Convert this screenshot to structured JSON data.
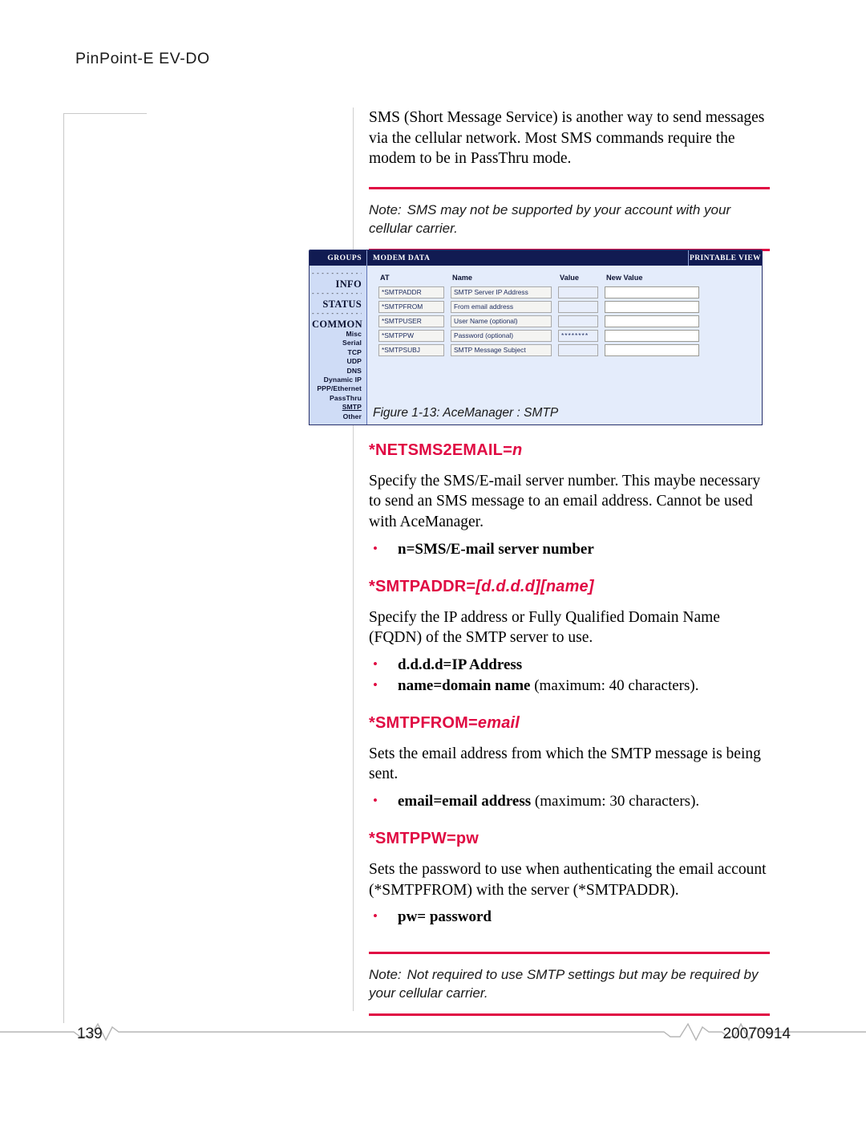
{
  "header": {
    "running_title": "PinPoint-E EV-DO"
  },
  "intro": {
    "paragraph": "SMS (Short Message Service) is another way to send messages via the cellular network. Most SMS commands require the modem to be in PassThru mode."
  },
  "note_top": {
    "label": "Note:",
    "text": "SMS may not be supported by your account with your cellular carrier."
  },
  "figure": {
    "caption": "Figure 1-13: AceManager : SMTP",
    "topbar": {
      "groups": "GROUPS",
      "modem_data": "MODEM DATA",
      "printable_view": "PRINTABLE VIEW"
    },
    "sidebar": {
      "dashes": "- - - - - - - - - - - -",
      "info": "INFO",
      "status": "STATUS",
      "common": "COMMON",
      "items": [
        "Misc",
        "Serial",
        "TCP",
        "UDP",
        "DNS",
        "Dynamic IP",
        "PPP/Ethernet",
        "PassThru",
        "SMTP",
        "Other"
      ],
      "active_item": "SMTP"
    },
    "table": {
      "columns": [
        "AT",
        "Name",
        "Value",
        "New Value"
      ],
      "rows": [
        {
          "at": "*SMTPADDR",
          "name": "SMTP Server IP Address",
          "value": "",
          "new_value": ""
        },
        {
          "at": "*SMTPFROM",
          "name": "From email address",
          "value": "",
          "new_value": ""
        },
        {
          "at": "*SMTPUSER",
          "name": "User Name (optional)",
          "value": "",
          "new_value": ""
        },
        {
          "at": "*SMTPPW",
          "name": "Password (optional)",
          "value": "********",
          "new_value": ""
        },
        {
          "at": "*SMTPSUBJ",
          "name": "SMTP Message Subject",
          "value": "",
          "new_value": ""
        }
      ]
    }
  },
  "sections": [
    {
      "command_prefix": "*NETSMS2EMAIL=",
      "command_arg": "n",
      "command_arg_italic": true,
      "description": "Specify the SMS/E-mail server number. This maybe necessary to send an SMS message to an email address. Cannot be used with AceManager.",
      "bullets": [
        {
          "bold": "n=SMS/E-mail server number",
          "plain": ""
        }
      ]
    },
    {
      "command_prefix": "*SMTPADDR=",
      "command_arg": "[d.d.d.d][name]",
      "command_arg_italic": true,
      "description": "Specify the IP address or Fully Qualified Domain Name (FQDN) of the SMTP server to use.",
      "bullets": [
        {
          "bold": "d.d.d.d=IP Address",
          "plain": ""
        },
        {
          "bold": "name=domain name",
          "plain": " (maximum: 40 characters)."
        }
      ]
    },
    {
      "command_prefix": "*SMTPFROM=",
      "command_arg": "email",
      "command_arg_italic": true,
      "description": "Sets the email address from which the SMTP message is being sent.",
      "bullets": [
        {
          "bold": "email=email address",
          "plain": " (maximum: 30 characters)."
        }
      ]
    },
    {
      "command_prefix": "*SMTPPW=",
      "command_arg": "pw",
      "command_arg_italic": false,
      "description": "Sets the password to use when authenticating the email account (*SMTPFROM) with the server (*SMTPADDR).",
      "bullets": [
        {
          "bold": "pw= password",
          "plain": ""
        }
      ]
    }
  ],
  "note_bottom": {
    "label": "Note:",
    "text": "Not required to use SMTP settings but may be required by your cellular carrier."
  },
  "footer": {
    "page_number": "139",
    "date": "20070914"
  },
  "colors": {
    "accent_rule": "#e00a43",
    "command_heading": "#e00a43",
    "ui_header_bar": "#111b52",
    "ui_panel_bg": "#e4ecfb",
    "ui_sidebar_bg": "#cfdcf6",
    "margin_rule": "#c9c9c9"
  }
}
